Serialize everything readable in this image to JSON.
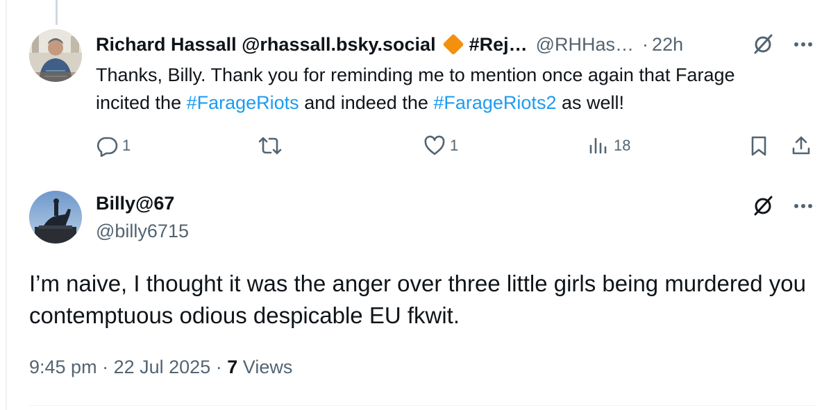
{
  "reply_tweet": {
    "display_name": "Richard Hassall @rhassall.bsky.social",
    "badge_icon": "orange-diamond-icon",
    "name_suffix": "#Rej…",
    "handle": "@RHHas…",
    "separator": "·",
    "time": "22h",
    "text_part1": "Thanks, Billy. Thank you for reminding me to mention once again that Farage incited the ",
    "hashtag1": "#FarageRiots",
    "text_part2": " and indeed the ",
    "hashtag2": "#FarageRiots2",
    "text_part3": " as well!",
    "actions": {
      "reply_count": "1",
      "repost_count": "",
      "like_count": "1",
      "views_count": "18"
    }
  },
  "main_tweet": {
    "display_name": "Billy@67",
    "handle": "@billy6715",
    "text": "I’m naive, I thought it was the anger over three little girls being murdered you contemptuous odious despicable EU fkwit.",
    "time": "9:45 pm",
    "date": "22 Jul 2025",
    "separator": "·",
    "views_count": "7",
    "views_label": "Views"
  },
  "colors": {
    "text": "#0f1419",
    "muted": "#536471",
    "link": "#1d9bf0",
    "badge": "#f4900c",
    "thread_line": "#cfd9de"
  }
}
